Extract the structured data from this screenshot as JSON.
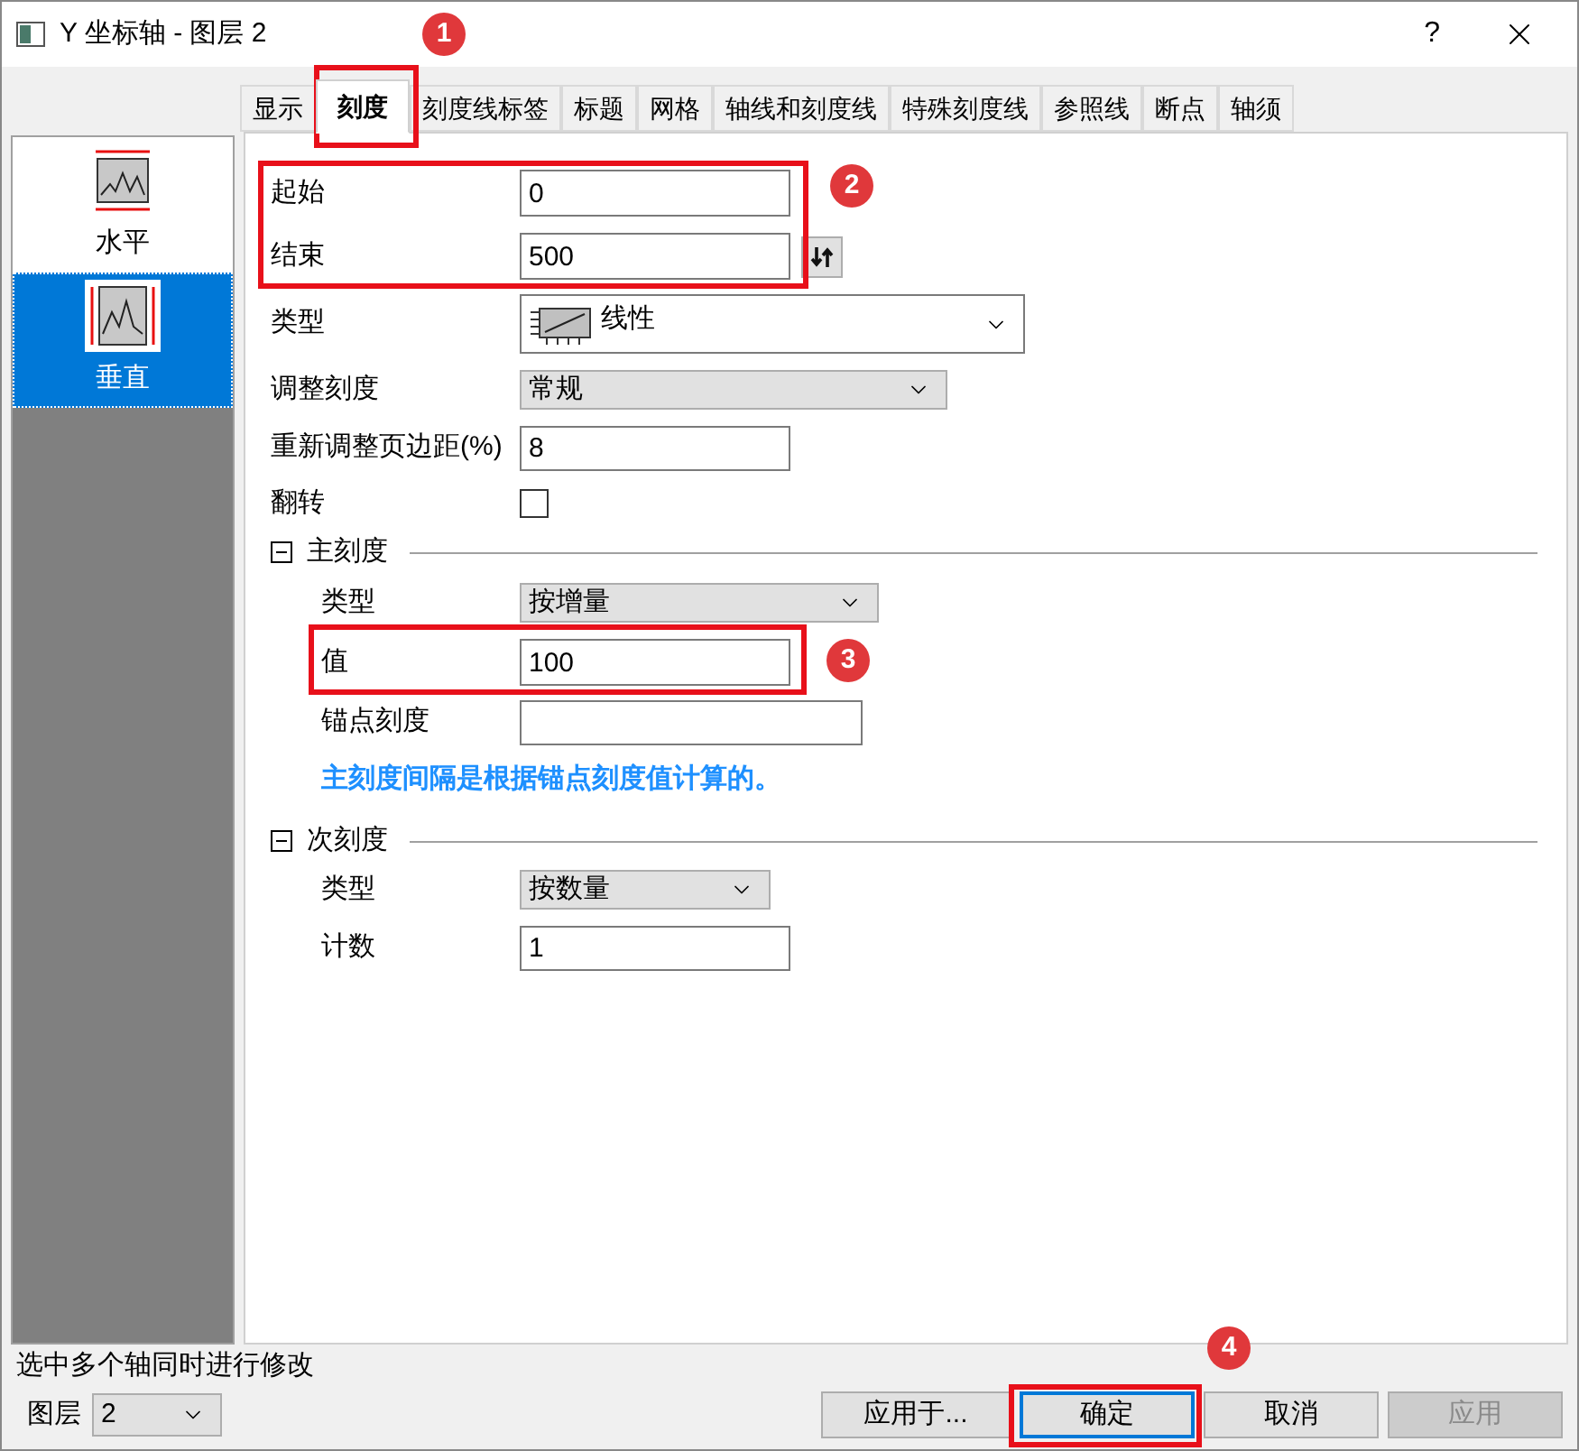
{
  "window": {
    "title": "Y 坐标轴 - 图层 2",
    "help": "?"
  },
  "tabs": [
    {
      "label": "显示",
      "selected": false
    },
    {
      "label": "刻度",
      "selected": true
    },
    {
      "label": "刻度线标签",
      "selected": false
    },
    {
      "label": "标题",
      "selected": false
    },
    {
      "label": "网格",
      "selected": false
    },
    {
      "label": "轴线和刻度线",
      "selected": false
    },
    {
      "label": "特殊刻度线",
      "selected": false
    },
    {
      "label": "参照线",
      "selected": false
    },
    {
      "label": "断点",
      "selected": false
    },
    {
      "label": "轴须",
      "selected": false
    }
  ],
  "sidebar": {
    "items": [
      {
        "label": "水平",
        "kind": "horizontal",
        "selected": false
      },
      {
        "label": "垂直",
        "kind": "vertical",
        "selected": true
      }
    ]
  },
  "scale": {
    "from": {
      "label": "起始",
      "value": "0"
    },
    "to": {
      "label": "结束",
      "value": "500"
    },
    "type": {
      "label": "类型",
      "value": "线性"
    },
    "rescale": {
      "label": "调整刻度",
      "value": "常规"
    },
    "margin": {
      "label": "重新调整页边距(%)",
      "value": "8"
    },
    "reverse": {
      "label": "翻转",
      "checked": false
    }
  },
  "major": {
    "title": "主刻度",
    "expanded": true,
    "type": {
      "label": "类型",
      "value": "按增量"
    },
    "value": {
      "label": "值",
      "value": "100"
    },
    "anchor": {
      "label": "锚点刻度"
    },
    "hint": "主刻度间隔是根据锚点刻度值计算的。"
  },
  "minor": {
    "title": "次刻度",
    "expanded": true,
    "type": {
      "label": "类型",
      "value": "按数量"
    },
    "count": {
      "label": "计数",
      "value": "1"
    }
  },
  "status": "选中多个轴同时进行修改",
  "layer": {
    "label": "图层",
    "value": "2"
  },
  "buttons": [
    {
      "label": "应用于...",
      "disabled": false,
      "selected": false
    },
    {
      "label": "确定",
      "disabled": false,
      "selected": true
    },
    {
      "label": "取消",
      "disabled": false,
      "selected": false
    },
    {
      "label": "应用",
      "disabled": true,
      "selected": false
    }
  ],
  "annotations": [
    {
      "number": "1"
    },
    {
      "number": "2"
    },
    {
      "number": "3"
    },
    {
      "number": "4"
    }
  ]
}
